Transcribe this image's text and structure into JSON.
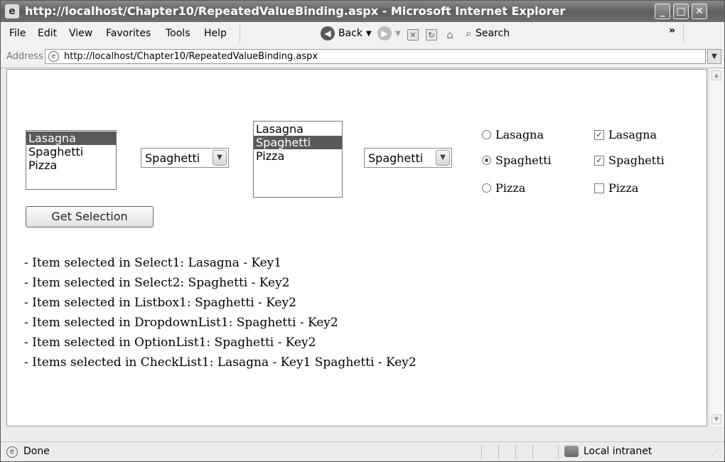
{
  "window": {
    "title": "http://localhost/Chapter10/RepeatedValueBinding.aspx - Microsoft Internet Explorer",
    "min_label": "_",
    "max_label": "□",
    "close_label": "✕"
  },
  "menubar": {
    "items": [
      "File",
      "Edit",
      "View",
      "Favorites",
      "Tools",
      "Help"
    ],
    "back_label": "Back",
    "search_label": "Search",
    "overflow": "»"
  },
  "address": {
    "label": "Address",
    "url": "http://localhost/Chapter10/RepeatedValueBinding.aspx"
  },
  "page": {
    "select1": {
      "options": [
        "Lasagna",
        "Spaghetti",
        "Pizza"
      ],
      "selected": "Lasagna"
    },
    "select2": {
      "value": "Spaghetti"
    },
    "listbox1": {
      "options": [
        "Lasagna",
        "Spaghetti",
        "Pizza"
      ],
      "selected": "Spaghetti"
    },
    "dropdown1": {
      "value": "Spaghetti"
    },
    "optionlist1": [
      {
        "label": "Lasagna",
        "checked": false
      },
      {
        "label": "Spaghetti",
        "checked": true
      },
      {
        "label": "Pizza",
        "checked": false
      }
    ],
    "checklist1": [
      {
        "label": "Lasagna",
        "checked": true
      },
      {
        "label": "Spaghetti",
        "checked": true
      },
      {
        "label": "Pizza",
        "checked": false
      }
    ],
    "button_label": "Get Selection",
    "results": [
      "- Item selected in Select1: Lasagna - Key1",
      "- Item selected in Select2: Spaghetti - Key2",
      "- Item selected in Listbox1: Spaghetti - Key2",
      "- Item selected in DropdownList1: Spaghetti - Key2",
      "- Item selected in OptionList1: Spaghetti - Key2",
      "- Items selected in CheckList1: Lasagna - Key1 Spaghetti - Key2"
    ]
  },
  "status": {
    "text": "Done",
    "zone": "Local intranet"
  }
}
